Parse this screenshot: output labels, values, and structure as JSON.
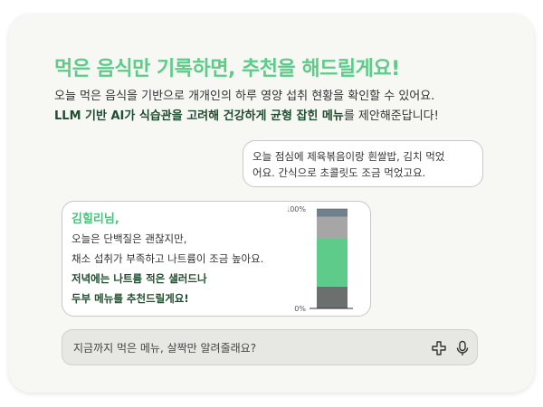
{
  "headline": "먹은 음식만 기록하면, 추천을 해드릴게요!",
  "description": {
    "line1": "오늘 먹은 음식을 기반으로 개개인의 하루 영양 섭취 현황을 확인할 수 있어요.",
    "line2_bold": "LLM 기반 AI가 식습관을 고려해 건강하게 균형 잡힌 메뉴",
    "line2_rest": "를 제안해준답니다!"
  },
  "user_message": {
    "line1": "오늘 점심에 제육볶음이랑 흰쌀밥, 김치 먹었",
    "line2": "어요. 간식으로 초콜릿도 조금 먹었고요."
  },
  "ai_message": {
    "name": "김힐리님,",
    "line1": "오늘은 단백질은 괜찮지만,",
    "line2": "채소 섭취가 부족하고 나트륨이 조금 높아요.",
    "line3": "저녁에는 나트륨 적은 샐러드나",
    "line4": "두부 메뉴를 추천드릴게요!"
  },
  "chart_data": {
    "type": "bar",
    "stacked": true,
    "tick_labels": [
      "100%",
      "0%"
    ],
    "segments_bottom_to_top": [
      {
        "value": 22,
        "color": "#6b6f6d"
      },
      {
        "value": 48,
        "color": "#5ecb8a"
      },
      {
        "value": 22,
        "color": "#a6a6a6"
      },
      {
        "value": 8,
        "color": "#717f8f"
      }
    ],
    "ylim": [
      0,
      100
    ]
  },
  "input": {
    "placeholder": "지금까지 먹은 메뉴, 살짝만 알려줄래요?"
  },
  "icons": {
    "add": "plus-icon",
    "voice": "microphone-icon"
  },
  "colors": {
    "accent": "#5ccc88",
    "dark_green": "#1f4d2d"
  }
}
